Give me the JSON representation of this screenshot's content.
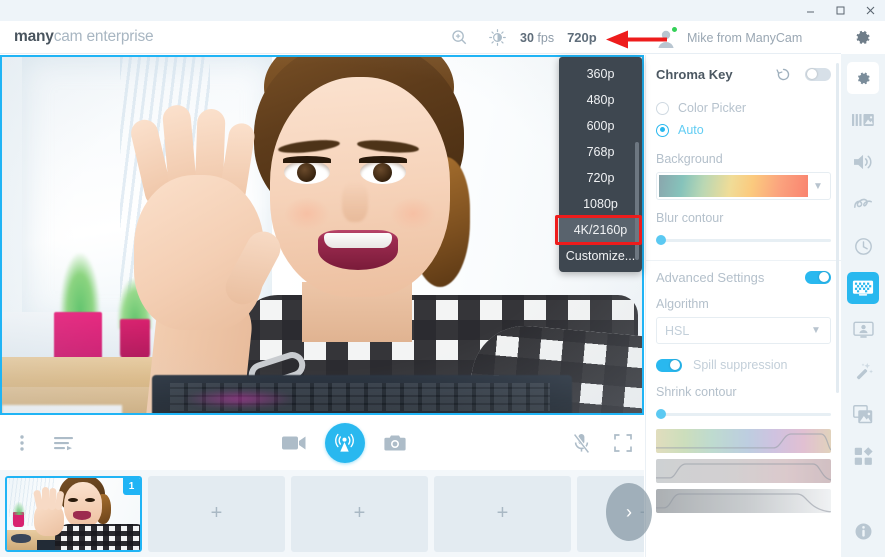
{
  "window": {
    "minimize_label": "–",
    "maximize_label": "☐",
    "close_label": "✕"
  },
  "header": {
    "logo_bold": "many",
    "logo_light": "cam enterprise",
    "zoom_icon": "zoom-in-icon",
    "brightness_icon": "brightness-icon",
    "fps_value": "30",
    "fps_unit": "fps",
    "resolution": "720p",
    "user_name": "Mike from ManyCam",
    "status": "online",
    "settings_icon": "gear-icon"
  },
  "resolution_menu": {
    "open": true,
    "selected": "4K/2160p",
    "items": [
      {
        "label": "360p"
      },
      {
        "label": "480p"
      },
      {
        "label": "600p"
      },
      {
        "label": "768p"
      },
      {
        "label": "720p"
      },
      {
        "label": "1080p"
      },
      {
        "label": "4K/2160p"
      },
      {
        "label": "Customize..."
      }
    ]
  },
  "annotations": {
    "arrow_color": "#ee1c1c",
    "box_color": "#ee1c1c",
    "arrow_target": "720p",
    "box_target": "4K/2160p"
  },
  "controls": {
    "more_icon": "more-vertical-icon",
    "playlist_icon": "playlist-icon",
    "video_icon": "video-camera-icon",
    "broadcast_icon": "broadcast-icon",
    "snapshot_icon": "camera-icon",
    "mic_icon": "microphone-muted-icon",
    "fullscreen_icon": "fullscreen-icon",
    "accent": "#29b8ef"
  },
  "thumbnails": {
    "active_badge": "1",
    "add_label": "+",
    "next_label": "›",
    "slots": [
      {
        "type": "preset",
        "label": ""
      },
      {
        "type": "empty",
        "label": "+"
      },
      {
        "type": "empty",
        "label": "+"
      },
      {
        "type": "empty",
        "label": "+"
      },
      {
        "type": "empty",
        "label": "+"
      }
    ]
  },
  "panel": {
    "title": "Chroma Key",
    "reset_icon": "reset-icon",
    "enabled": false,
    "mode": {
      "color_picker": "Color Picker",
      "auto": "Auto",
      "selected": "Auto"
    },
    "background_label": "Background",
    "background_value": "",
    "blur_contour_label": "Blur contour",
    "blur_contour_value": 0,
    "advanced_settings_label": "Advanced Settings",
    "advanced_enabled": true,
    "algorithm_label": "Algorithm",
    "algorithm_value": "HSL",
    "spill_suppression_label": "Spill suppression",
    "spill_enabled": true,
    "shrink_contour_label": "Shrink contour",
    "shrink_contour_value": 0,
    "curves": [
      {
        "name": "hue-range"
      },
      {
        "name": "saturation-range"
      },
      {
        "name": "lightness-range"
      }
    ]
  },
  "rail": {
    "items": [
      {
        "icon": "gear-icon",
        "active": false
      },
      {
        "icon": "video-layers-icon",
        "active": false
      },
      {
        "icon": "speaker-icon",
        "active": false
      },
      {
        "icon": "draw-icon",
        "active": false
      },
      {
        "icon": "clock-icon",
        "active": false
      },
      {
        "icon": "chroma-key-icon",
        "active": true
      },
      {
        "icon": "presenter-icon",
        "active": false
      },
      {
        "icon": "magic-wand-icon",
        "active": false
      },
      {
        "icon": "images-icon",
        "active": false
      },
      {
        "icon": "apps-icon",
        "active": false
      }
    ],
    "info_icon": "info-icon"
  }
}
